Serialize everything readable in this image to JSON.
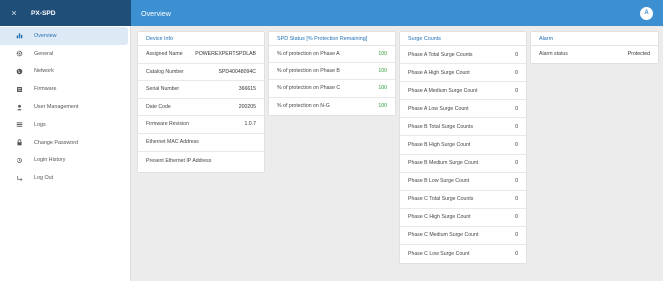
{
  "app": {
    "close_glyph": "×",
    "title": "PX-SPD"
  },
  "header": {
    "page_title": "Overview",
    "avatar_letter": "A"
  },
  "sidebar": {
    "items": [
      {
        "label": "Overview",
        "icon": "bar-chart-icon"
      },
      {
        "label": "General",
        "icon": "gear-icon"
      },
      {
        "label": "Network",
        "icon": "globe-icon"
      },
      {
        "label": "Firmware",
        "icon": "memory-chip-icon"
      },
      {
        "label": "User Management",
        "icon": "person-icon"
      },
      {
        "label": "Logs",
        "icon": "list-icon"
      },
      {
        "label": "Change Password",
        "icon": "lock-icon"
      },
      {
        "label": "Login History",
        "icon": "history-icon"
      },
      {
        "label": "Log Out",
        "icon": "logout-arrow-icon"
      }
    ]
  },
  "device_info": {
    "title": "Device Info",
    "rows": [
      {
        "label": "Assigned Name",
        "value": "POWEREXPERTSPDLAB"
      },
      {
        "label": "Catalog Number",
        "value": "SPD40048094C"
      },
      {
        "label": "Serial Number",
        "value": "366615"
      },
      {
        "label": "Date Code",
        "value": "200205"
      },
      {
        "label": "Firmware Revision",
        "value": "1.0.7"
      },
      {
        "label": "Ethernet MAC Address",
        "value": ""
      },
      {
        "label": "Present Ethernet IP Address",
        "value": ""
      }
    ]
  },
  "spd_status": {
    "title": "SPD Status [% Protection Remaining]",
    "rows": [
      {
        "label": "% of protection on Phase A",
        "value": "100"
      },
      {
        "label": "% of protection on Phase B",
        "value": "100"
      },
      {
        "label": "% of protection on Phase C",
        "value": "100"
      },
      {
        "label": "% of protection on N-G",
        "value": "100"
      }
    ]
  },
  "surge_counts": {
    "title": "Surge Counts",
    "rows": [
      {
        "label": "Phase A Total Surge Counts",
        "value": "0"
      },
      {
        "label": "Phase A High Surge Count",
        "value": "0"
      },
      {
        "label": "Phase A Medium Surge Count",
        "value": "0"
      },
      {
        "label": "Phase A Low Surge Count",
        "value": "0"
      },
      {
        "label": "Phase B Total Surge Counts",
        "value": "0"
      },
      {
        "label": "Phase B High Surge Count",
        "value": "0"
      },
      {
        "label": "Phase B Medium Surge Count",
        "value": "0"
      },
      {
        "label": "Phase B Low Surge Count",
        "value": "0"
      },
      {
        "label": "Phase C Total Surge Counts",
        "value": "0"
      },
      {
        "label": "Phase C High Surge Count",
        "value": "0"
      },
      {
        "label": "Phase C Medium Surge Count",
        "value": "0"
      },
      {
        "label": "Phase C Low Surge Count",
        "value": "0"
      }
    ]
  },
  "alarm": {
    "title": "Alarm",
    "rows": [
      {
        "label": "Alarm status",
        "value": "Protected"
      }
    ]
  },
  "colors": {
    "brand": "#1f4e79",
    "header": "#3c8fd0",
    "accent": "#1f6fb5",
    "ok_green": "#2e9e33"
  }
}
